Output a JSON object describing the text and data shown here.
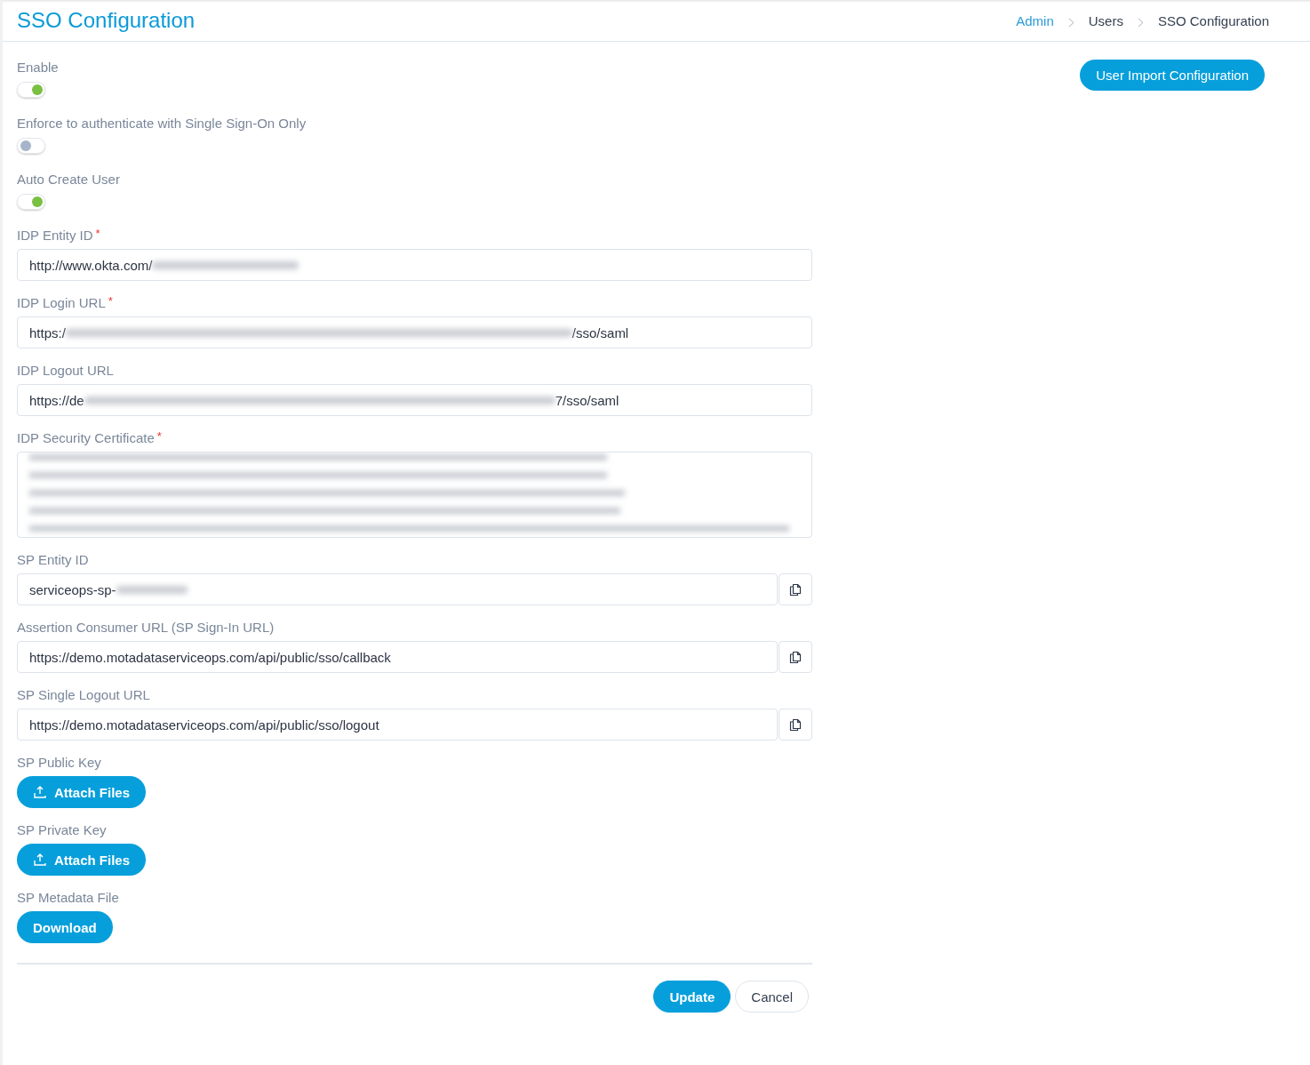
{
  "header": {
    "title": "SSO Configuration",
    "breadcrumb": [
      {
        "label": "Admin",
        "link": true
      },
      {
        "label": "Users",
        "link": false
      },
      {
        "label": "SSO Configuration",
        "link": false
      }
    ]
  },
  "side_button": "User Import Configuration",
  "toggles": [
    {
      "label": "Enable",
      "on": true
    },
    {
      "label": "Enforce to authenticate with Single Sign-On Only",
      "on": false
    },
    {
      "label": "Auto Create User",
      "on": true
    }
  ],
  "fields": [
    {
      "kind": "text",
      "label": "IDP Entity ID",
      "required_mark": "*",
      "value": "http://www.okta.com/",
      "redacted": true,
      "copyable": false
    },
    {
      "kind": "text",
      "label": "IDP Login URL",
      "required_mark": "*",
      "value": "https:/",
      "redacted": true,
      "value_end": "/sso/saml",
      "copyable": false
    },
    {
      "kind": "text",
      "label": "IDP Logout URL",
      "value": "https://de",
      "redacted": true,
      "value_end": "7/sso/saml",
      "copyable": false
    },
    {
      "kind": "textarea",
      "label": "IDP Security Certificate",
      "required_mark": "*",
      "redacted": true
    },
    {
      "kind": "text",
      "label": "SP Entity ID",
      "value": "serviceops-sp-",
      "redacted": true,
      "copyable": true
    },
    {
      "kind": "text",
      "label": "Assertion Consumer URL (SP Sign-In URL)",
      "value": "https://demo.motadataserviceops.com/api/public/sso/callback",
      "redacted": false,
      "copyable": true
    },
    {
      "kind": "text",
      "label": "SP Single Logout URL",
      "value": "https://demo.motadataserviceops.com/api/public/sso/logout",
      "redacted": false,
      "copyable": true
    },
    {
      "kind": "attach",
      "label": "SP Public Key",
      "button": "Attach Files"
    },
    {
      "kind": "attach",
      "label": "SP Private Key",
      "button": "Attach Files"
    },
    {
      "kind": "download",
      "label": "SP Metadata File",
      "button": "Download"
    }
  ],
  "actions": [
    {
      "label": "Update",
      "primary": true
    },
    {
      "label": "Cancel",
      "primary": false
    }
  ]
}
